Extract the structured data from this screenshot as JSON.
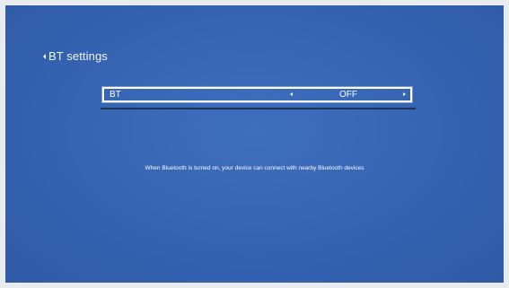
{
  "header": {
    "back_title": "BT settings"
  },
  "setting": {
    "label": "BT",
    "value": "OFF"
  },
  "info_text": "When Bluetooth is turned on, your device can connect with nearby Bluetooth devices",
  "colors": {
    "screen_bg": "#3563b2",
    "text": "#ffffff",
    "divider": "#1e3552"
  },
  "icons": {
    "back": "chevron-left-icon",
    "prev": "caret-left-icon",
    "next": "caret-right-icon"
  }
}
